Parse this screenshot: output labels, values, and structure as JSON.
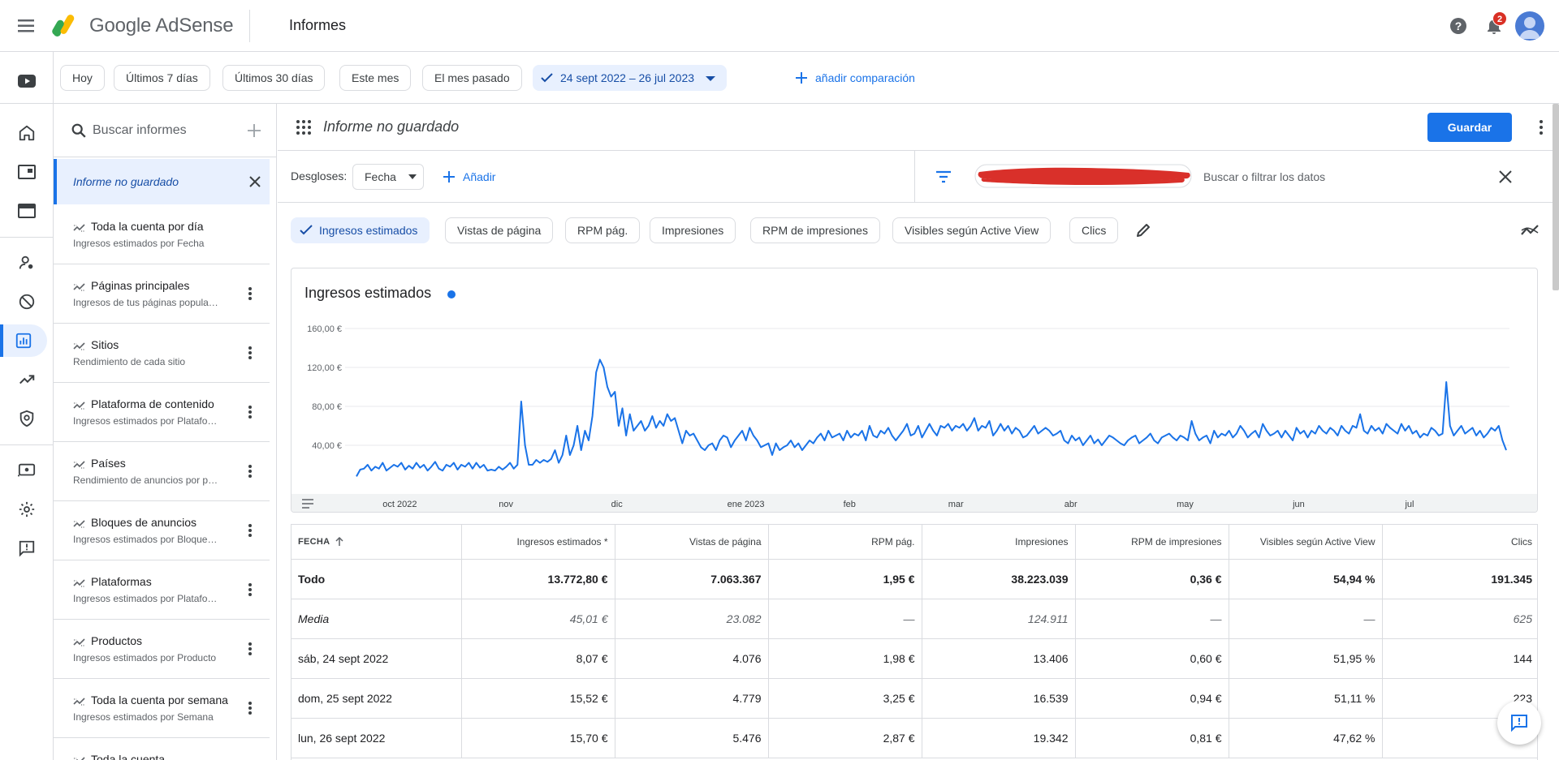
{
  "app": {
    "brand": "Google AdSense",
    "page_title": "Informes",
    "notifications_count": "2"
  },
  "date_filters": [
    "Hoy",
    "Últimos 7 días",
    "Últimos 30 días",
    "Este mes",
    "El mes pasado"
  ],
  "date_range": "24 sept 2022 – 26 jul 2023",
  "add_comparison": "añadir comparación",
  "reports_panel": {
    "search_placeholder": "Buscar informes",
    "active_report": "Informe no guardado",
    "items": [
      {
        "title": "Toda la cuenta por día",
        "subtitle": "Ingresos estimados por Fecha"
      },
      {
        "title": "Páginas principales",
        "subtitle": "Ingresos de tus páginas populares"
      },
      {
        "title": "Sitios",
        "subtitle": "Rendimiento de cada sitio"
      },
      {
        "title": "Plataforma de contenido",
        "subtitle": "Ingresos estimados por Plataforma"
      },
      {
        "title": "Países",
        "subtitle": "Rendimiento de anuncios por país"
      },
      {
        "title": "Bloques de anuncios",
        "subtitle": "Ingresos estimados por Bloque de anuncios"
      },
      {
        "title": "Plataformas",
        "subtitle": "Ingresos estimados por Plataforma"
      },
      {
        "title": "Productos",
        "subtitle": "Ingresos estimados por Producto"
      },
      {
        "title": "Toda la cuenta por semana",
        "subtitle": "Ingresos estimados por Semana"
      },
      {
        "title": "Toda la cuenta",
        "subtitle": ""
      }
    ]
  },
  "report": {
    "name": "Informe no guardado",
    "save_label": "Guardar",
    "breakdowns_label": "Desgloses:",
    "breakdown_value": "Fecha",
    "add_label": "Añadir",
    "data_search_placeholder": "Buscar o filtrar los datos"
  },
  "metric_chips": [
    {
      "label": "Ingresos estimados",
      "selected": true
    },
    {
      "label": "Vistas de página",
      "selected": false
    },
    {
      "label": "RPM pág.",
      "selected": false
    },
    {
      "label": "Impresiones",
      "selected": false
    },
    {
      "label": "RPM de impresiones",
      "selected": false
    },
    {
      "label": "Visibles según Active View",
      "selected": false
    },
    {
      "label": "Clics",
      "selected": false
    }
  ],
  "colors": {
    "accent": "#1a73e8",
    "accent_light": "#e8f0fe",
    "badge": "#d93025",
    "redaction": "#d9302a"
  },
  "chart_data": {
    "type": "line",
    "title": "Ingresos estimados",
    "y_tick_labels": [
      "40,00 €",
      "80,00 €",
      "120,00 €",
      "160,00 €"
    ],
    "ylim": [
      0,
      175
    ],
    "x_tick_labels": [
      "oct 2022",
      "nov",
      "dic",
      "ene 2023",
      "feb",
      "mar",
      "abr",
      "may",
      "jun",
      "jul"
    ],
    "x_tick_days": [
      7,
      38,
      68,
      99,
      130,
      158,
      189,
      219,
      250,
      280
    ],
    "series": [
      {
        "name": "Ingresos estimados",
        "color": "#1a73e8",
        "values": [
          8,
          15,
          16,
          20,
          14,
          18,
          16,
          22,
          14,
          17,
          20,
          18,
          22,
          15,
          19,
          16,
          22,
          17,
          20,
          14,
          18,
          23,
          16,
          14,
          20,
          18,
          22,
          15,
          20,
          18,
          22,
          16,
          22,
          17,
          20,
          14,
          15,
          14,
          18,
          15,
          18,
          22,
          16,
          20,
          85,
          40,
          20,
          20,
          25,
          22,
          25,
          23,
          26,
          35,
          22,
          30,
          50,
          30,
          40,
          60,
          35,
          55,
          45,
          70,
          115,
          128,
          120,
          100,
          90,
          95,
          60,
          78,
          50,
          72,
          55,
          60,
          65,
          55,
          60,
          70,
          58,
          65,
          60,
          72,
          65,
          68,
          55,
          42,
          55,
          50,
          52,
          45,
          38,
          35,
          40,
          42,
          35,
          45,
          50,
          48,
          38,
          45,
          50,
          55,
          45,
          58,
          50,
          45,
          38,
          40,
          42,
          30,
          42,
          35,
          38,
          40,
          45,
          38,
          42,
          35,
          40,
          45,
          42,
          48,
          52,
          45,
          55,
          48,
          50,
          52,
          45,
          55,
          48,
          52,
          50,
          55,
          45,
          60,
          50,
          48,
          55,
          52,
          58,
          50,
          45,
          50,
          55,
          62,
          50,
          52,
          60,
          48,
          55,
          62,
          55,
          50,
          60,
          58,
          62,
          55,
          60,
          58,
          62,
          55,
          60,
          68,
          55,
          60,
          58,
          65,
          50,
          55,
          62,
          55,
          60,
          52,
          58,
          55,
          48,
          50,
          55,
          60,
          52,
          55,
          58,
          55,
          50,
          52,
          55,
          45,
          42,
          50,
          45,
          48,
          40,
          45,
          50,
          42,
          46,
          40,
          45,
          50,
          48,
          45,
          42,
          40,
          45,
          48,
          50,
          42,
          45,
          48,
          52,
          45,
          42,
          48,
          50,
          52,
          48,
          45,
          50,
          48,
          45,
          65,
          52,
          45,
          48,
          50,
          42,
          55,
          48,
          52,
          50,
          55,
          48,
          52,
          60,
          55,
          48,
          52,
          55,
          48,
          62,
          55,
          50,
          52,
          55,
          48,
          55,
          50,
          45,
          58,
          52,
          55,
          48,
          55,
          52,
          60,
          55,
          52,
          58,
          55,
          50,
          60,
          55,
          52,
          60,
          58,
          72,
          55,
          52,
          60,
          55,
          58,
          52,
          62,
          58,
          55,
          52,
          62,
          55,
          60,
          52,
          55,
          48,
          52,
          50,
          58,
          55,
          50,
          52,
          105,
          60,
          50,
          55,
          60,
          52,
          55,
          58,
          50,
          55,
          48,
          52,
          58,
          55,
          60,
          45,
          35
        ]
      }
    ]
  },
  "table": {
    "headers": [
      "FECHA",
      "Ingresos estimados *",
      "Vistas de página",
      "RPM pág.",
      "Impresiones",
      "RPM de impresiones",
      "Visibles según Active View",
      "Clics"
    ],
    "rows": [
      {
        "type": "total",
        "cells": [
          "Todo",
          "13.772,80 €",
          "7.063.367",
          "1,95 €",
          "38.223.039",
          "0,36 €",
          "54,94 %",
          "191.345"
        ]
      },
      {
        "type": "media",
        "cells": [
          "Media",
          "45,01 €",
          "23.082",
          "—",
          "124.911",
          "—",
          "—",
          "625"
        ]
      },
      {
        "type": "row",
        "cells": [
          "sáb, 24 sept 2022",
          "8,07 €",
          "4.076",
          "1,98 €",
          "13.406",
          "0,60 €",
          "51,95 %",
          "144"
        ]
      },
      {
        "type": "row",
        "cells": [
          "dom, 25 sept 2022",
          "15,52 €",
          "4.779",
          "3,25 €",
          "16.539",
          "0,94 €",
          "51,11 %",
          "223"
        ]
      },
      {
        "type": "row",
        "cells": [
          "lun, 26 sept 2022",
          "15,70 €",
          "5.476",
          "2,87 €",
          "19.342",
          "0,81 €",
          "47,62 %",
          ""
        ]
      }
    ]
  }
}
